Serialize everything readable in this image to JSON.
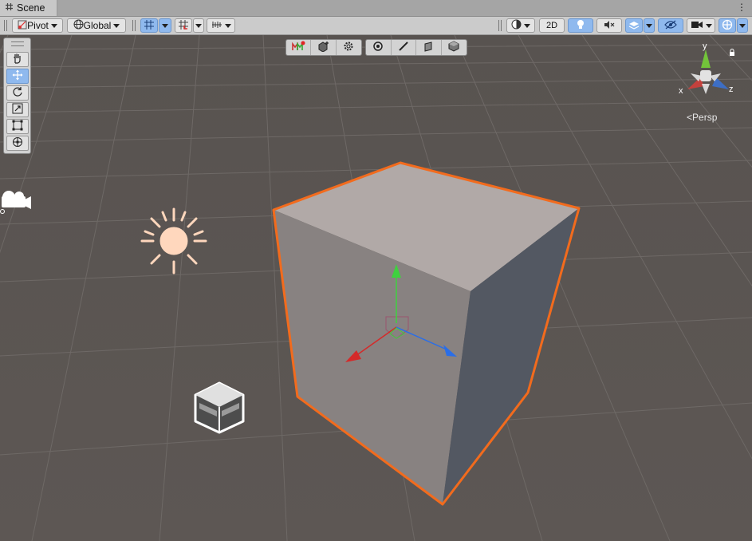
{
  "window": {
    "tab_label": "Scene",
    "menu_glyph": "⋮"
  },
  "toolbar": {
    "pivot_label": "Pivot",
    "global_label": "Global",
    "mode_2d_label": "2D"
  },
  "tools": [
    "hand",
    "move",
    "rotate",
    "scale",
    "rect",
    "transform"
  ],
  "overlays": {
    "group1": [
      "gizmo-toggle",
      "component-add",
      "settings"
    ],
    "group2": [
      "pivot-view",
      "line",
      "face",
      "cube"
    ]
  },
  "gizmo": {
    "x_label": "x",
    "y_label": "y",
    "z_label": "z",
    "projection_label": "Persp"
  },
  "colors": {
    "viewport_bg": "#5a5551",
    "selection_outline": "#f26b1d",
    "axis_x": "#d42a2a",
    "axis_y": "#3fd13f",
    "axis_z": "#2a6ee8",
    "accent_on": "#8fb9ee"
  }
}
